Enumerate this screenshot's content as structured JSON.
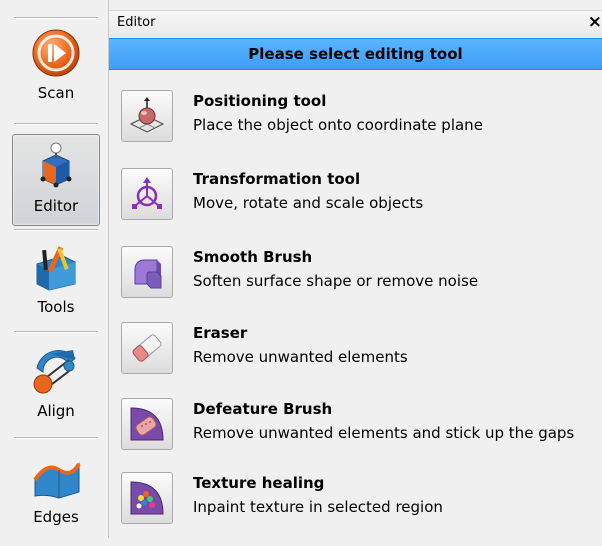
{
  "sidebar": {
    "items": [
      {
        "label": "Scan",
        "icon": "scan-icon"
      },
      {
        "label": "Editor",
        "icon": "editor-icon",
        "active": true
      },
      {
        "label": "Tools",
        "icon": "tools-icon"
      },
      {
        "label": "Align",
        "icon": "align-icon"
      },
      {
        "label": "Edges",
        "icon": "edges-icon"
      }
    ]
  },
  "panel": {
    "title": "Editor",
    "close_label": "×",
    "banner": "Please select editing tool",
    "tools": [
      {
        "name": "Positioning tool",
        "desc": "Place the object onto coordinate plane",
        "icon": "positioning-icon"
      },
      {
        "name": "Transformation tool",
        "desc": "Move, rotate and scale objects",
        "icon": "transformation-icon"
      },
      {
        "name": "Smooth Brush",
        "desc": "Soften surface shape or remove noise",
        "icon": "smooth-brush-icon"
      },
      {
        "name": "Eraser",
        "desc": "Remove unwanted elements",
        "icon": "eraser-icon"
      },
      {
        "name": "Defeature Brush",
        "desc": "Remove unwanted elements and stick up the gaps",
        "icon": "defeature-brush-icon"
      },
      {
        "name": "Texture healing",
        "desc": "Inpaint texture in selected region",
        "icon": "texture-healing-icon"
      }
    ]
  },
  "colors": {
    "banner": "#3d9dfa",
    "accent_orange": "#e8661e",
    "accent_blue": "#2f86c8"
  }
}
